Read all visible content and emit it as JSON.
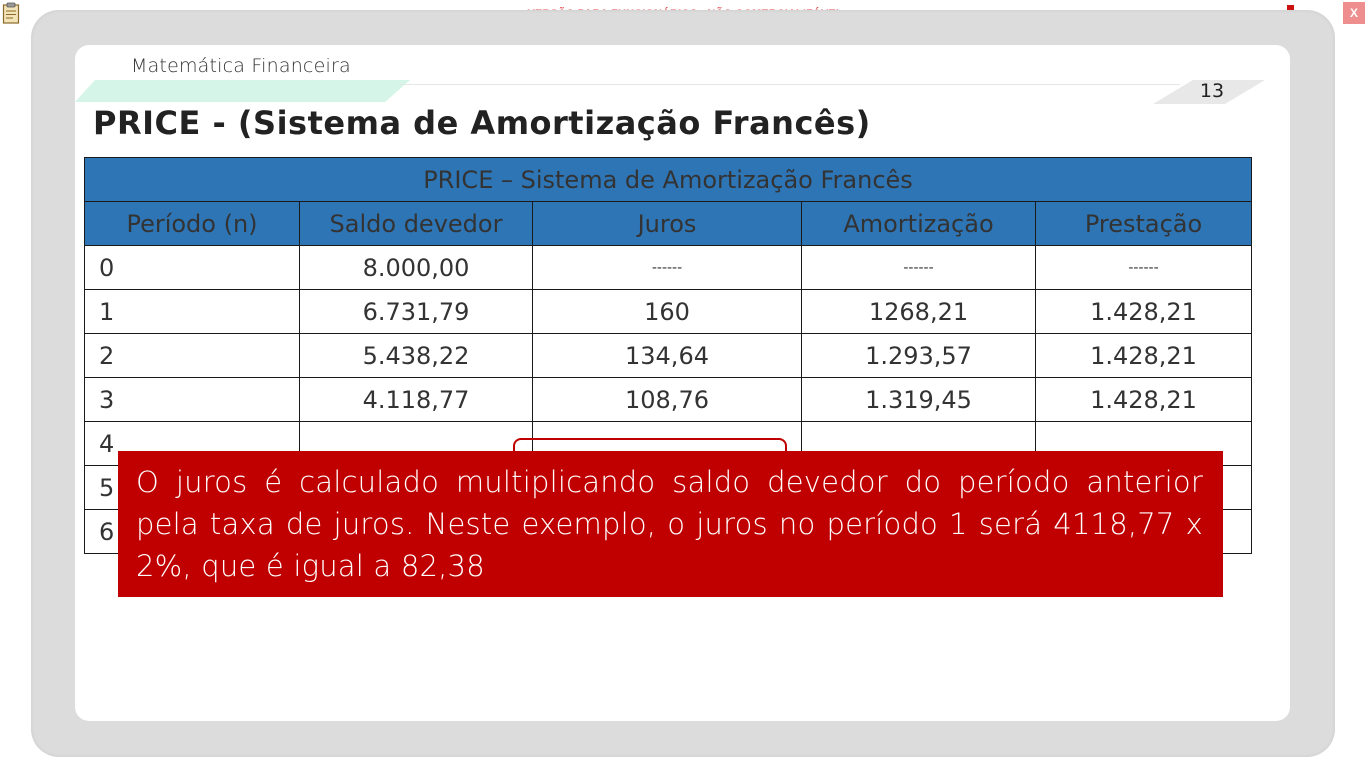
{
  "app": {
    "banner": "VERSÃO PARA FUNCIONÁRIOS - NÃO COMERCIALIZÁVEL",
    "close_label": "X"
  },
  "slide": {
    "course": "Matemática Financeira",
    "page_number": "13",
    "title": "PRICE - (Sistema de Amortização Francês)"
  },
  "table": {
    "caption": "PRICE – Sistema de Amortização Francês",
    "headers": [
      "Período (n)",
      "Saldo devedor",
      "Juros",
      "Amortização",
      "Prestação"
    ],
    "rows": [
      [
        "0",
        "8.000,00",
        "------",
        "------",
        "------"
      ],
      [
        "1",
        "6.731,79",
        "160",
        "1268,21",
        "1.428,21"
      ],
      [
        "2",
        "5.438,22",
        "134,64",
        "1.293,57",
        "1.428,21"
      ],
      [
        "3",
        "4.118,77",
        "108,76",
        "1.319,45",
        "1.428,21"
      ],
      [
        "4",
        "",
        "",
        "",
        ""
      ],
      [
        "5",
        "",
        "",
        "",
        ""
      ],
      [
        "6",
        "",
        "",
        "",
        ""
      ]
    ]
  },
  "callout": {
    "text": "O juros é calculado multiplicando saldo devedor do período anterior pela taxa de juros. Neste exemplo, o juros no período 1 será 4118,77 x 2%, que é igual a 82,38"
  },
  "colors": {
    "table_header": "#2e75b6",
    "callout": "#c00000",
    "header_accent": "#d4f5e8"
  }
}
